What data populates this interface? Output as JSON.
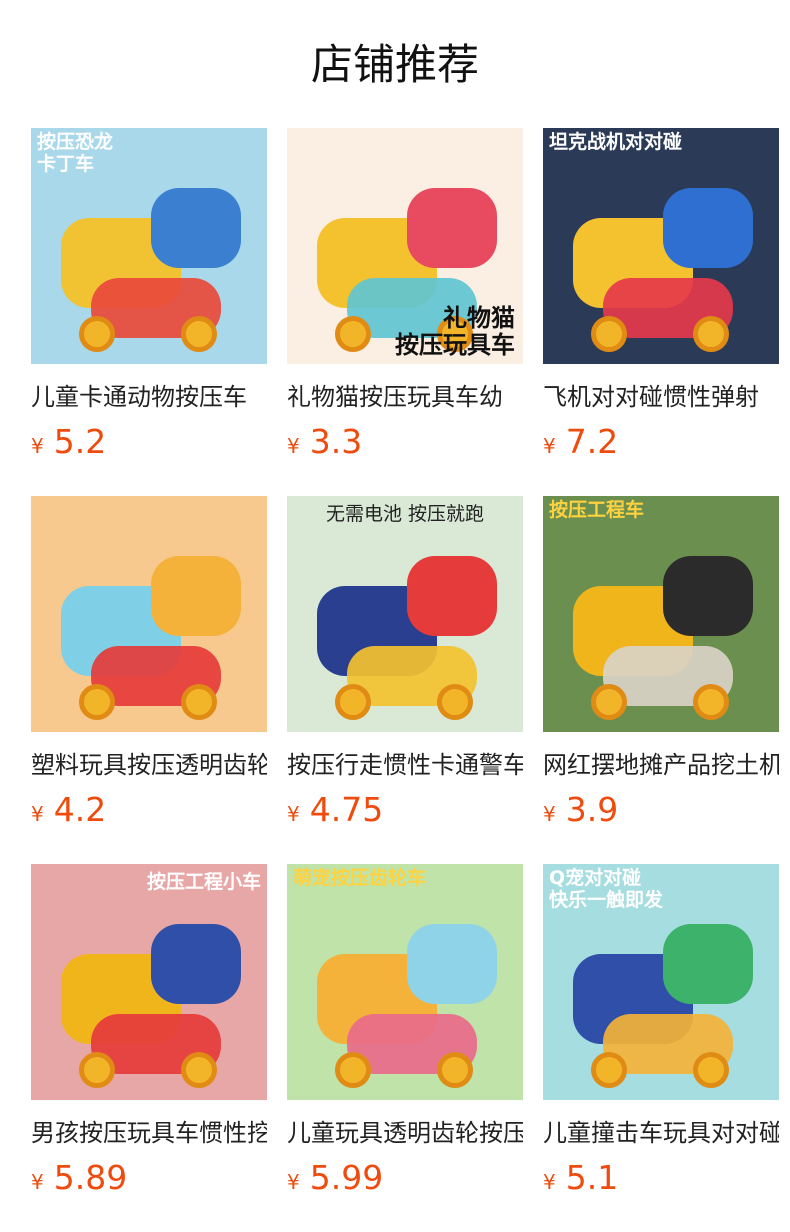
{
  "section": {
    "title": "店铺推荐"
  },
  "currency_symbol": "¥",
  "products": [
    {
      "name": "儿童卡通动物按压车",
      "price": "5.2",
      "image": {
        "caption": "按压恐龙\n卡丁车",
        "bg": "#a9d8ea",
        "accent": "#f1c232",
        "accent2": "#3b7fd0",
        "accent3": "#e94a3a",
        "caption_color": "#ffffff",
        "caption_pos": "top-left",
        "icon": "dinosaur-kart-icon"
      }
    },
    {
      "name": "礼物猫按压玩具车幼",
      "price": "3.3",
      "image": {
        "caption": "礼物猫\n按压玩具车",
        "bg": "#fbeee2",
        "accent": "#f4c22f",
        "accent2": "#e84a5f",
        "accent3": "#5fc6d2",
        "caption_color": "#111111",
        "caption_pos": "bottom-right",
        "icon": "gift-cat-car-icon"
      }
    },
    {
      "name": "飞机对对碰惯性弹射",
      "price": "7.2",
      "image": {
        "caption": "坦克战机对对碰",
        "bg": "#2b3a57",
        "accent": "#f4c22f",
        "accent2": "#2f6fd1",
        "accent3": "#e5394a",
        "caption_color": "#ffffff",
        "caption_pos": "top-left",
        "icon": "tank-plane-icon"
      }
    },
    {
      "name": "塑料玩具按压透明齿轮",
      "price": "4.2",
      "image": {
        "caption": "",
        "bg": "#f8c98f",
        "accent": "#7fd0e6",
        "accent2": "#f4b23a",
        "accent3": "#e53b3b",
        "caption_color": "#ffffff",
        "caption_pos": "top-left",
        "icon": "transparent-gear-bus-icon"
      }
    },
    {
      "name": "按压行走惯性卡通警车",
      "price": "4.75",
      "image": {
        "caption": "无需电池 按压就跑",
        "bg": "#d9e9d6",
        "accent": "#2a3f8f",
        "accent2": "#e53b3b",
        "accent3": "#f4c22f",
        "caption_color": "#222222",
        "caption_pos": "top-center",
        "icon": "police-fire-car-icon"
      }
    },
    {
      "name": "网红摆地摊产品挖土机",
      "price": "3.9",
      "image": {
        "caption": "按压工程车",
        "bg": "#6b8f4e",
        "accent": "#f1b51c",
        "accent2": "#2b2b2b",
        "accent3": "#d9d2c5",
        "caption_color": "#ffd23f",
        "caption_pos": "top-left",
        "icon": "excavator-icon"
      }
    },
    {
      "name": "男孩按压玩具车惯性挖",
      "price": "5.89",
      "image": {
        "caption": "按压工程小车",
        "bg": "#e8a7a7",
        "accent": "#f1b51c",
        "accent2": "#2f4fa8",
        "accent3": "#e53b3b",
        "caption_color": "#ffffff",
        "caption_pos": "top-right",
        "icon": "construction-truck-icon"
      }
    },
    {
      "name": "儿童玩具透明齿轮按压",
      "price": "5.99",
      "image": {
        "caption": "萌宠按压齿轮车",
        "bg": "#bfe3a9",
        "accent": "#f4b23a",
        "accent2": "#8fd3e8",
        "accent3": "#e86a8a",
        "caption_color": "#ffd23f",
        "caption_pos": "top-left",
        "icon": "giraffe-gear-car-icon"
      }
    },
    {
      "name": "儿童撞击车玩具对对碰",
      "price": "5.1",
      "image": {
        "caption": "Q宠对对碰\n快乐一触即发",
        "bg": "#a6dde0",
        "accent": "#2f4fa8",
        "accent2": "#3cb26b",
        "accent3": "#f4b23a",
        "caption_color": "#ffffff",
        "caption_pos": "top-left",
        "icon": "panda-corgi-car-icon"
      }
    }
  ]
}
